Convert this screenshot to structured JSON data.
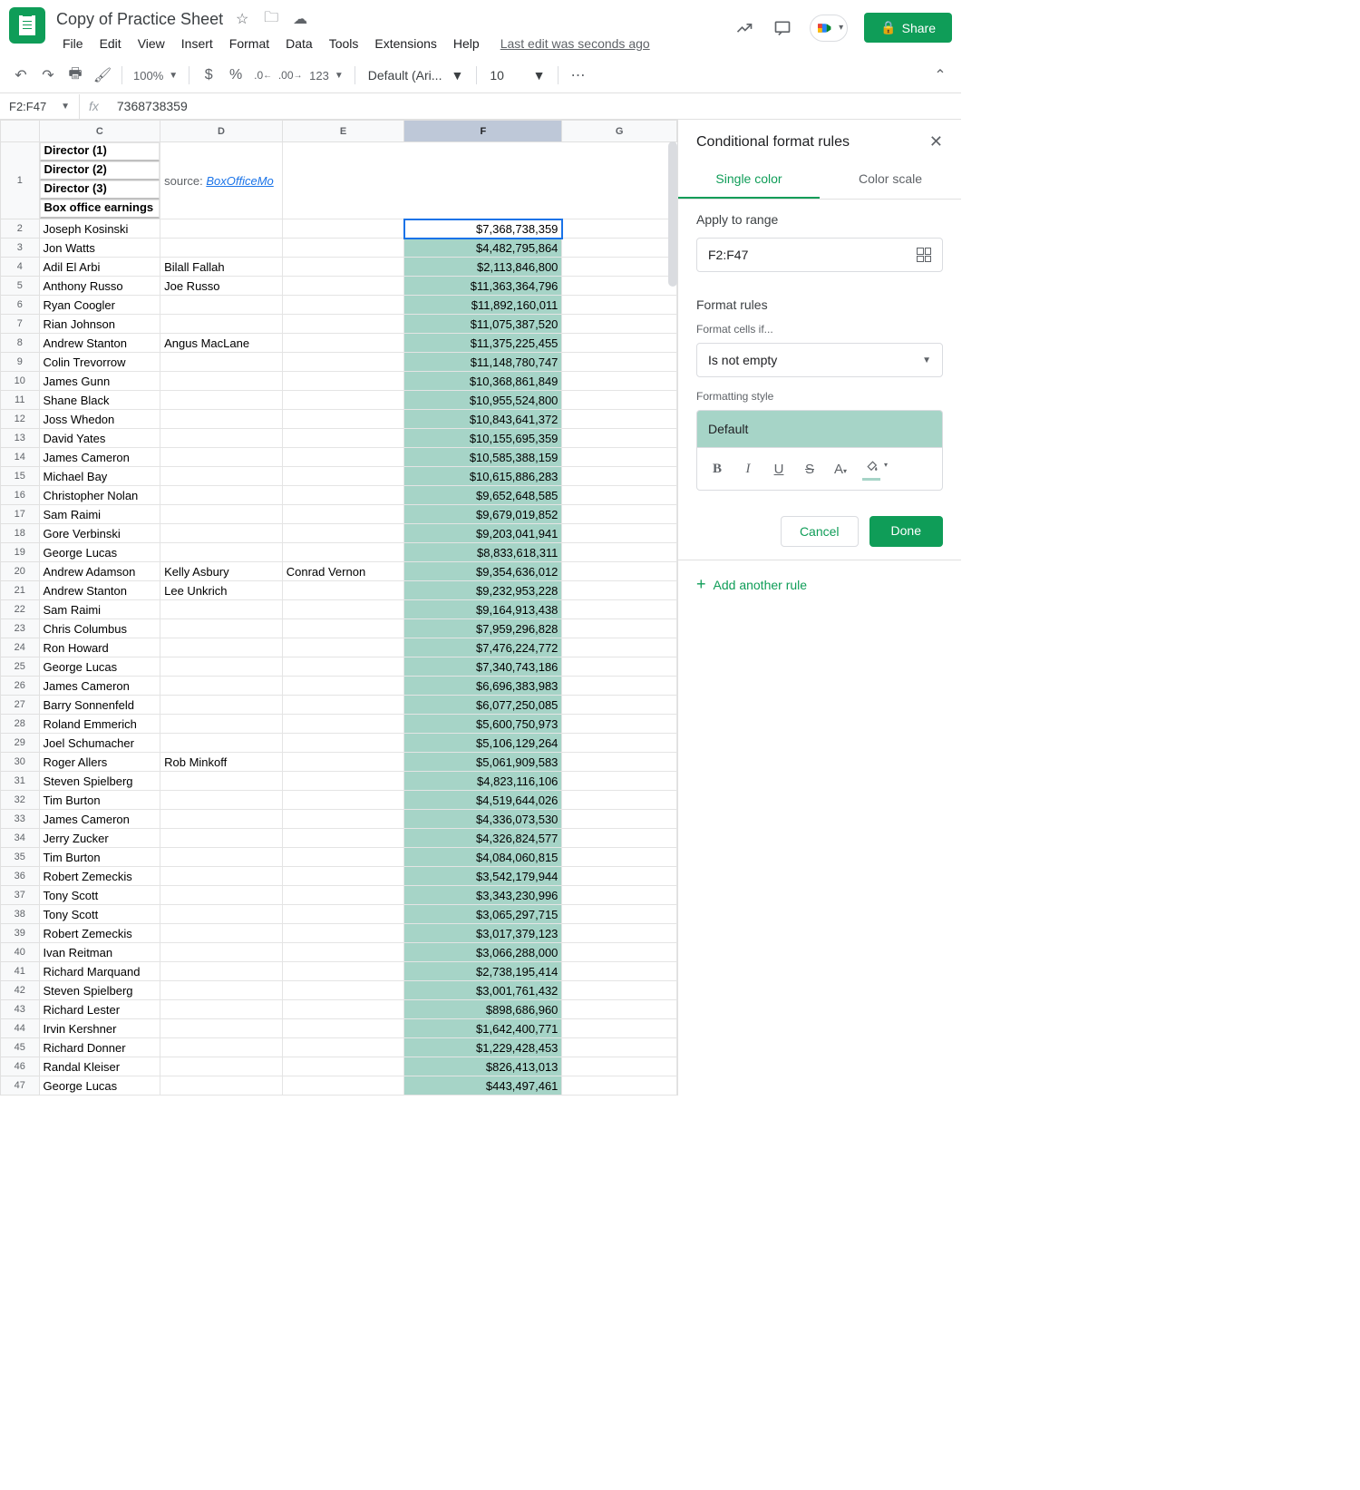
{
  "header": {
    "title": "Copy of Practice Sheet",
    "menu": [
      "File",
      "Edit",
      "View",
      "Insert",
      "Format",
      "Data",
      "Tools",
      "Extensions",
      "Help"
    ],
    "last_edit": "Last edit was seconds ago",
    "share": "Share"
  },
  "toolbar": {
    "zoom": "100%",
    "font_name": "Default (Ari...",
    "font_size": "10",
    "number_format": "123"
  },
  "namebox": {
    "range": "F2:F47",
    "formula": "7368738359"
  },
  "columns": [
    "C",
    "D",
    "E",
    "F",
    "G"
  ],
  "selected_col": "F",
  "sheet_headers": {
    "c": "Director (1)",
    "d": "Director (2)",
    "e": "Director (3)",
    "f": "Box office earnings",
    "g_label": "source: ",
    "g_link": "BoxOfficeMo"
  },
  "rows": [
    {
      "n": 2,
      "c": "Joseph Kosinski",
      "d": "",
      "e": "",
      "f": "$7,368,738,359"
    },
    {
      "n": 3,
      "c": "Jon Watts",
      "d": "",
      "e": "",
      "f": "$4,482,795,864"
    },
    {
      "n": 4,
      "c": "Adil El Arbi",
      "d": "Bilall Fallah",
      "e": "",
      "f": "$2,113,846,800"
    },
    {
      "n": 5,
      "c": "Anthony Russo",
      "d": "Joe Russo",
      "e": "",
      "f": "$11,363,364,796"
    },
    {
      "n": 6,
      "c": "Ryan Coogler",
      "d": "",
      "e": "",
      "f": "$11,892,160,011"
    },
    {
      "n": 7,
      "c": "Rian Johnson",
      "d": "",
      "e": "",
      "f": "$11,075,387,520"
    },
    {
      "n": 8,
      "c": "Andrew Stanton",
      "d": "Angus MacLane",
      "e": "",
      "f": "$11,375,225,455"
    },
    {
      "n": 9,
      "c": "Colin Trevorrow",
      "d": "",
      "e": "",
      "f": "$11,148,780,747"
    },
    {
      "n": 10,
      "c": "James Gunn",
      "d": "",
      "e": "",
      "f": "$10,368,861,849"
    },
    {
      "n": 11,
      "c": "Shane Black",
      "d": "",
      "e": "",
      "f": "$10,955,524,800"
    },
    {
      "n": 12,
      "c": "Joss Whedon",
      "d": "",
      "e": "",
      "f": "$10,843,641,372"
    },
    {
      "n": 13,
      "c": "David Yates",
      "d": "",
      "e": "",
      "f": "$10,155,695,359"
    },
    {
      "n": 14,
      "c": "James Cameron",
      "d": "",
      "e": "",
      "f": "$10,585,388,159"
    },
    {
      "n": 15,
      "c": "Michael Bay",
      "d": "",
      "e": "",
      "f": "$10,615,886,283"
    },
    {
      "n": 16,
      "c": "Christopher Nolan",
      "d": "",
      "e": "",
      "f": "$9,652,648,585"
    },
    {
      "n": 17,
      "c": "Sam Raimi",
      "d": "",
      "e": "",
      "f": "$9,679,019,852"
    },
    {
      "n": 18,
      "c": "Gore Verbinski",
      "d": "",
      "e": "",
      "f": "$9,203,041,941"
    },
    {
      "n": 19,
      "c": "George Lucas",
      "d": "",
      "e": "",
      "f": "$8,833,618,311"
    },
    {
      "n": 20,
      "c": "Andrew Adamson",
      "d": "Kelly Asbury",
      "e": "Conrad Vernon",
      "f": "$9,354,636,012"
    },
    {
      "n": 21,
      "c": "Andrew Stanton",
      "d": "Lee Unkrich",
      "e": "",
      "f": "$9,232,953,228"
    },
    {
      "n": 22,
      "c": "Sam Raimi",
      "d": "",
      "e": "",
      "f": "$9,164,913,438"
    },
    {
      "n": 23,
      "c": "Chris Columbus",
      "d": "",
      "e": "",
      "f": "$7,959,296,828"
    },
    {
      "n": 24,
      "c": "Ron Howard",
      "d": "",
      "e": "",
      "f": "$7,476,224,772"
    },
    {
      "n": 25,
      "c": "George Lucas",
      "d": "",
      "e": "",
      "f": "$7,340,743,186"
    },
    {
      "n": 26,
      "c": "James Cameron",
      "d": "",
      "e": "",
      "f": "$6,696,383,983"
    },
    {
      "n": 27,
      "c": "Barry Sonnenfeld",
      "d": "",
      "e": "",
      "f": "$6,077,250,085"
    },
    {
      "n": 28,
      "c": "Roland Emmerich",
      "d": "",
      "e": "",
      "f": "$5,600,750,973"
    },
    {
      "n": 29,
      "c": "Joel Schumacher",
      "d": "",
      "e": "",
      "f": "$5,106,129,264"
    },
    {
      "n": 30,
      "c": "Roger Allers",
      "d": "Rob Minkoff",
      "e": "",
      "f": "$5,061,909,583"
    },
    {
      "n": 31,
      "c": "Steven Spielberg",
      "d": "",
      "e": "",
      "f": "$4,823,116,106"
    },
    {
      "n": 32,
      "c": "Tim Burton",
      "d": "",
      "e": "",
      "f": "$4,519,644,026"
    },
    {
      "n": 33,
      "c": "James Cameron",
      "d": "",
      "e": "",
      "f": "$4,336,073,530"
    },
    {
      "n": 34,
      "c": "Jerry Zucker",
      "d": "",
      "e": "",
      "f": "$4,326,824,577"
    },
    {
      "n": 35,
      "c": "Tim Burton",
      "d": "",
      "e": "",
      "f": "$4,084,060,815"
    },
    {
      "n": 36,
      "c": "Robert Zemeckis",
      "d": "",
      "e": "",
      "f": "$3,542,179,944"
    },
    {
      "n": 37,
      "c": "Tony Scott",
      "d": "",
      "e": "",
      "f": "$3,343,230,996"
    },
    {
      "n": 38,
      "c": "Tony Scott",
      "d": "",
      "e": "",
      "f": "$3,065,297,715"
    },
    {
      "n": 39,
      "c": "Robert Zemeckis",
      "d": "",
      "e": "",
      "f": "$3,017,379,123"
    },
    {
      "n": 40,
      "c": "Ivan Reitman",
      "d": "",
      "e": "",
      "f": "$3,066,288,000"
    },
    {
      "n": 41,
      "c": "Richard Marquand",
      "d": "",
      "e": "",
      "f": "$2,738,195,414"
    },
    {
      "n": 42,
      "c": "Steven Spielberg",
      "d": "",
      "e": "",
      "f": "$3,001,761,432"
    },
    {
      "n": 43,
      "c": "Richard Lester",
      "d": "",
      "e": "",
      "f": "$898,686,960"
    },
    {
      "n": 44,
      "c": "Irvin Kershner",
      "d": "",
      "e": "",
      "f": "$1,642,400,771"
    },
    {
      "n": 45,
      "c": "Richard Donner",
      "d": "",
      "e": "",
      "f": "$1,229,428,453"
    },
    {
      "n": 46,
      "c": "Randal Kleiser",
      "d": "",
      "e": "",
      "f": "$826,413,013"
    },
    {
      "n": 47,
      "c": "George Lucas",
      "d": "",
      "e": "",
      "f": "$443,497,461"
    }
  ],
  "panel": {
    "title": "Conditional format rules",
    "tab_single": "Single color",
    "tab_scale": "Color scale",
    "apply_label": "Apply to range",
    "range_value": "F2:F47",
    "rules_heading": "Format rules",
    "rules_sublabel": "Format cells if...",
    "condition": "Is not empty",
    "style_heading": "Formatting style",
    "style_name": "Default",
    "cancel": "Cancel",
    "done": "Done",
    "add_rule": "Add another rule"
  }
}
